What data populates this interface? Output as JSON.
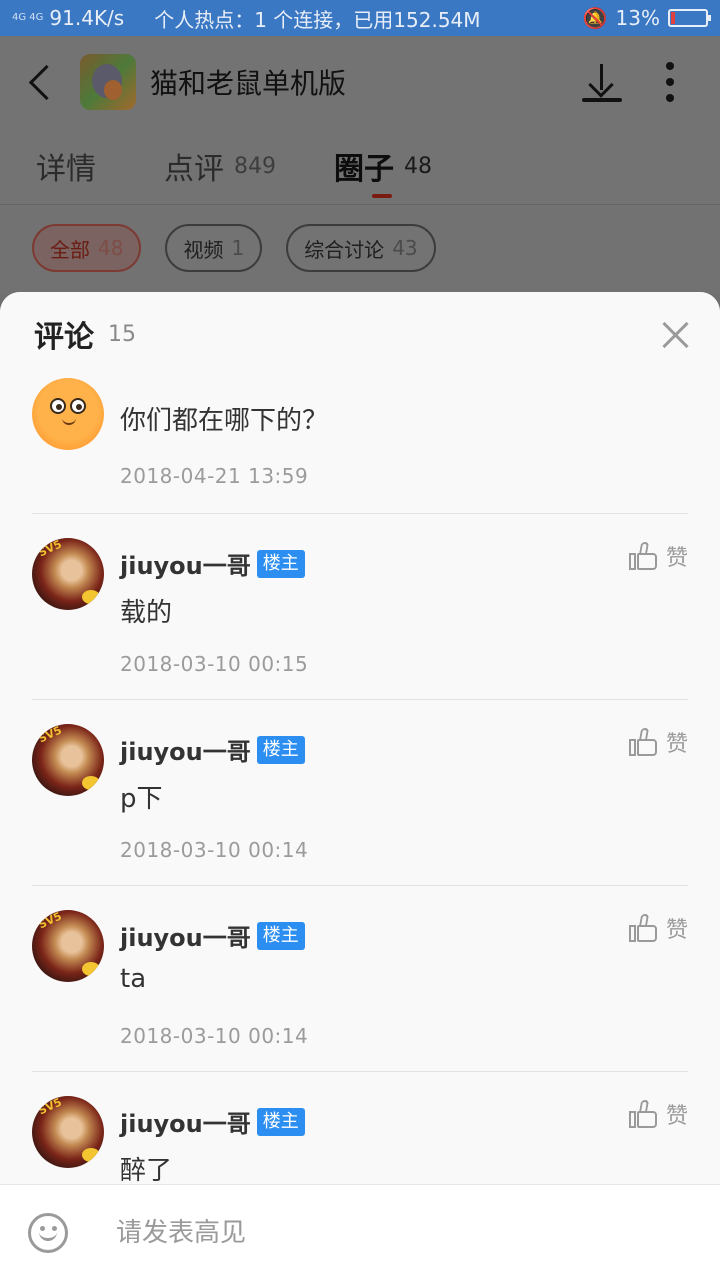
{
  "status_bar": {
    "signal": "4G 4G",
    "speed": "91.4K/s",
    "hotspot": "个人热点：1 个连接，已用152.54M",
    "battery_percent": "13%",
    "battery_level": 0.13,
    "icons": [
      "signal-icon",
      "mute-bell-icon",
      "battery-icon"
    ]
  },
  "header": {
    "app_title": "猫和老鼠单机版",
    "icons": [
      "back-icon",
      "game-icon",
      "download-icon",
      "more-icon"
    ]
  },
  "tabs": [
    {
      "label": "详情",
      "count": ""
    },
    {
      "label": "点评",
      "count": "849"
    },
    {
      "label": "圈子",
      "count": "48",
      "active": true
    }
  ],
  "filters": [
    {
      "label": "全部",
      "count": "48",
      "active": true
    },
    {
      "label": "视频",
      "count": "1"
    },
    {
      "label": "综合讨论",
      "count": "43"
    }
  ],
  "sheet": {
    "title": "评论",
    "count": "15"
  },
  "comments": [
    {
      "username": "",
      "badge": "",
      "content": "你们都在哪下的？",
      "time": "2018-04-21  13:59",
      "like_label": ""
    },
    {
      "username": "jiuyou一哥",
      "badge": "楼主",
      "content": "载的",
      "time": "2018-03-10  00:15",
      "like_label": "赞"
    },
    {
      "username": "jiuyou一哥",
      "badge": "楼主",
      "content": "p下",
      "time": "2018-03-10  00:14",
      "like_label": "赞"
    },
    {
      "username": "jiuyou一哥",
      "badge": "楼主",
      "content": "ta",
      "time": "2018-03-10  00:14",
      "like_label": "赞"
    },
    {
      "username": "jiuyou一哥",
      "badge": "楼主",
      "content": "醉了",
      "time": "",
      "like_label": "赞"
    }
  ],
  "input_bar": {
    "placeholder": "请发表高见",
    "value": "",
    "icon": "smile-icon"
  }
}
